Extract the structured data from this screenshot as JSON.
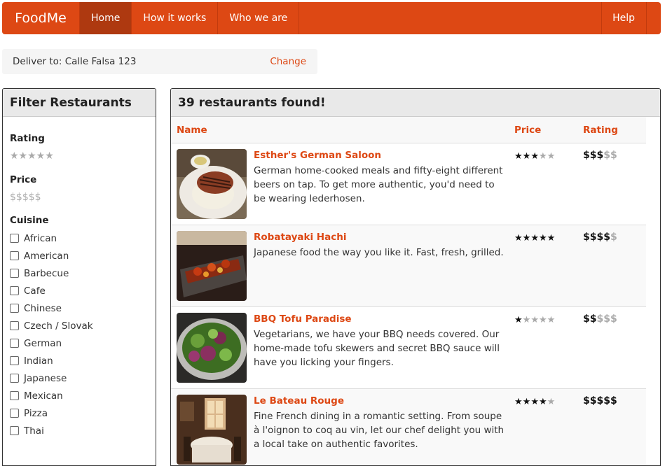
{
  "nav": {
    "brand": "FoodMe",
    "items": [
      {
        "label": "Home",
        "active": true
      },
      {
        "label": "How it works",
        "active": false
      },
      {
        "label": "Who we are",
        "active": false
      }
    ],
    "help": "Help"
  },
  "delivery": {
    "text": "Deliver to: Calle Falsa 123",
    "change": "Change"
  },
  "filter": {
    "title": "Filter Restaurants",
    "rating_label": "Rating",
    "rating_stars": "★★★★★",
    "price_label": "Price",
    "price_dollars": "$$$$$",
    "cuisine_label": "Cuisine",
    "cuisines": [
      "African",
      "American",
      "Barbecue",
      "Cafe",
      "Chinese",
      "Czech / Slovak",
      "German",
      "Indian",
      "Japanese",
      "Mexican",
      "Pizza",
      "Thai"
    ]
  },
  "results": {
    "title": "39 restaurants found!",
    "headers": {
      "name": "Name",
      "price": "Price",
      "rating": "Rating"
    },
    "rows": [
      {
        "name": "Esther's German Saloon",
        "description": "German home-cooked meals and fifty-eight different beers on tap. To get more authentic, you'd need to be wearing lederhosen.",
        "stars": 3,
        "price": 3,
        "image_icon": "steak-plate-icon"
      },
      {
        "name": "Robatayaki Hachi",
        "description": "Japanese food the way you like it. Fast, fresh, grilled.",
        "stars": 5,
        "price": 4,
        "image_icon": "grilled-skewers-icon"
      },
      {
        "name": "BBQ Tofu Paradise",
        "description": "Vegetarians, we have your BBQ needs covered. Our home-made tofu skewers and secret BBQ sauce will have you licking your fingers.",
        "stars": 1,
        "price": 2,
        "image_icon": "salad-bowl-icon"
      },
      {
        "name": "Le Bateau Rouge",
        "description": "Fine French dining in a romantic setting. From soupe à l'oignon to coq au vin, let our chef delight you with a local take on authentic favorites.",
        "stars": 4,
        "price": 5,
        "image_icon": "restaurant-interior-icon"
      }
    ]
  },
  "colors": {
    "accent": "#dd4814",
    "nav_active": "#ae3910"
  }
}
